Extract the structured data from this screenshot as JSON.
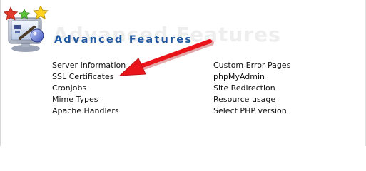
{
  "section": {
    "title": "Advanced Features",
    "watermark": "Advanced Features",
    "icon": "advanced-features-icon"
  },
  "links_left": [
    {
      "label": "Server Information"
    },
    {
      "label": "SSL Certificates"
    },
    {
      "label": "Cronjobs"
    },
    {
      "label": "Mime Types"
    },
    {
      "label": "Apache Handlers"
    }
  ],
  "links_right": [
    {
      "label": "Custom Error Pages"
    },
    {
      "label": "phpMyAdmin"
    },
    {
      "label": "Site Redirection"
    },
    {
      "label": "Resource usage"
    },
    {
      "label": "Select PHP version"
    }
  ],
  "annotation": {
    "icon": "red-arrow-icon",
    "color": "#e8141a"
  },
  "colors": {
    "title": "#1e56a0",
    "link": "#111111",
    "watermark": "#eeeeee"
  }
}
